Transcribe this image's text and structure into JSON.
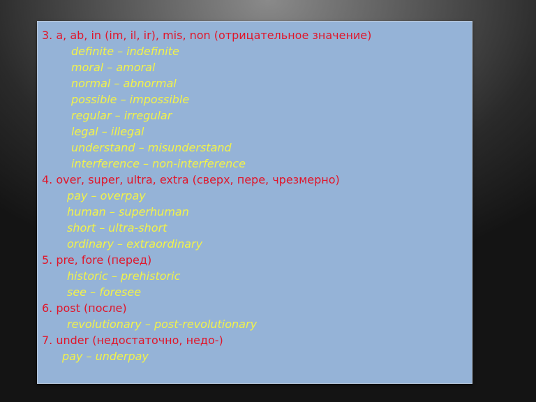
{
  "sections": [
    {
      "heading": "3. a, ab, in (im, il, ir), mis, non (отрицательное значение)",
      "examples": [
        "definite – indefinite",
        "moral – amoral",
        "normal – abnormal",
        "possible – impossible",
        "regular – irregular",
        "legal – illegal",
        "understand – misunderstand",
        "interference – non-interference"
      ]
    },
    {
      "heading": "4. over, super, ultra, extra (сверх, пере, чрезмерно)",
      "examples": [
        "pay – overpay",
        "human – superhuman",
        "short – ultra-short",
        "ordinary – extraordinary"
      ]
    },
    {
      "heading": "5. pre, fore (перед)",
      "examples": [
        "historic – prehistoric",
        "see – foresee"
      ]
    },
    {
      "heading": "6. post (после)",
      "examples": [
        "revolutionary – post-revolutionary"
      ]
    },
    {
      "heading": "7. under (недостаточно, недо-)",
      "examples": [
        "pay – underpay"
      ]
    }
  ],
  "colors": {
    "heading": "#e0162a",
    "example": "#f2f24a",
    "panel": "#95b3d7"
  }
}
